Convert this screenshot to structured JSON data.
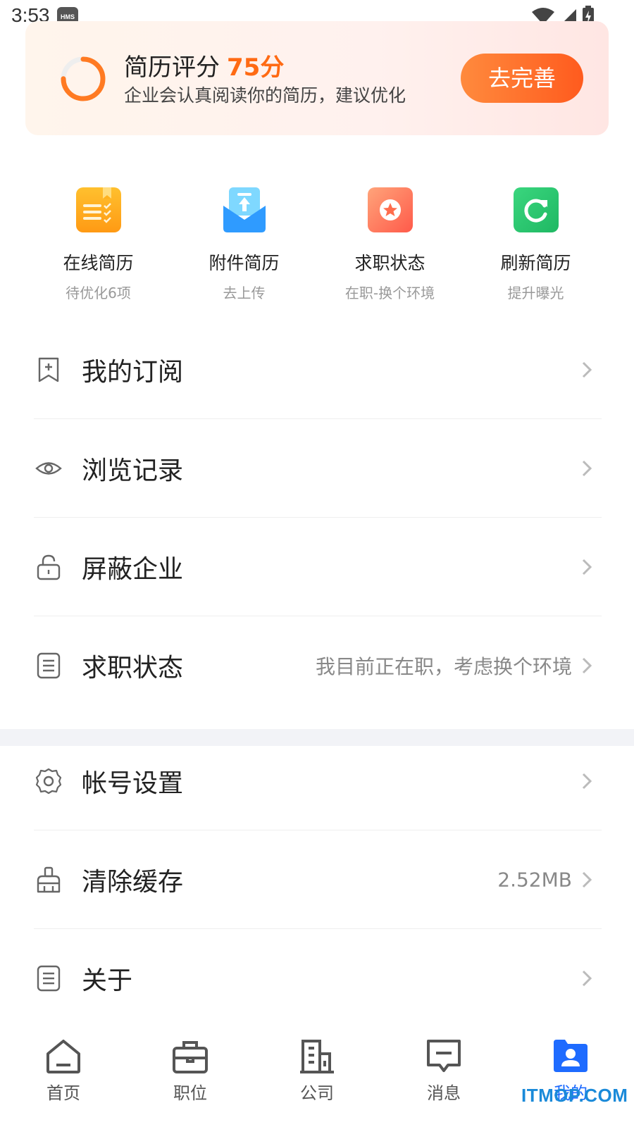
{
  "status_bar": {
    "time": "3:53",
    "badge": "HMS"
  },
  "score_card": {
    "title": "简历评分",
    "score": "75分",
    "subtitle": "企业会认真阅读你的简历，建议优化",
    "button": "去完善",
    "accent_color": "#ff6a13",
    "progress": 0.75
  },
  "quick_actions": [
    {
      "icon": "online-resume-icon",
      "label": "在线简历",
      "sub": "待优化6项",
      "color": "#ffa31a"
    },
    {
      "icon": "attachment-upload-icon",
      "label": "附件简历",
      "sub": "去上传",
      "color": "#2f9bff"
    },
    {
      "icon": "star-status-icon",
      "label": "求职状态",
      "sub": "在职-换个环境",
      "color": "#ff6d4d"
    },
    {
      "icon": "refresh-icon",
      "label": "刷新简历",
      "sub": "提升曝光",
      "color": "#25c26e"
    }
  ],
  "menu": [
    {
      "icon": "bookmark-icon",
      "label": "我的订阅",
      "value": ""
    },
    {
      "icon": "eye-icon",
      "label": "浏览记录",
      "value": ""
    },
    {
      "icon": "lock-icon",
      "label": "屏蔽企业",
      "value": ""
    },
    {
      "icon": "document-icon",
      "label": "求职状态",
      "value": "我目前正在职，考虑换个环境"
    },
    {
      "icon": "gear-icon",
      "label": "帐号设置",
      "value": ""
    },
    {
      "icon": "broom-icon",
      "label": "清除缓存",
      "value": "2.52MB"
    },
    {
      "icon": "document-icon",
      "label": "关于",
      "value": ""
    }
  ],
  "bottom_nav": [
    {
      "icon": "home-icon",
      "label": "首页",
      "active": false
    },
    {
      "icon": "briefcase-icon",
      "label": "职位",
      "active": false
    },
    {
      "icon": "building-icon",
      "label": "公司",
      "active": false
    },
    {
      "icon": "message-icon",
      "label": "消息",
      "active": false
    },
    {
      "icon": "profile-icon",
      "label": "我的",
      "active": true
    }
  ],
  "active_color": "#1e6bff",
  "watermark": "ITMOP.COM"
}
